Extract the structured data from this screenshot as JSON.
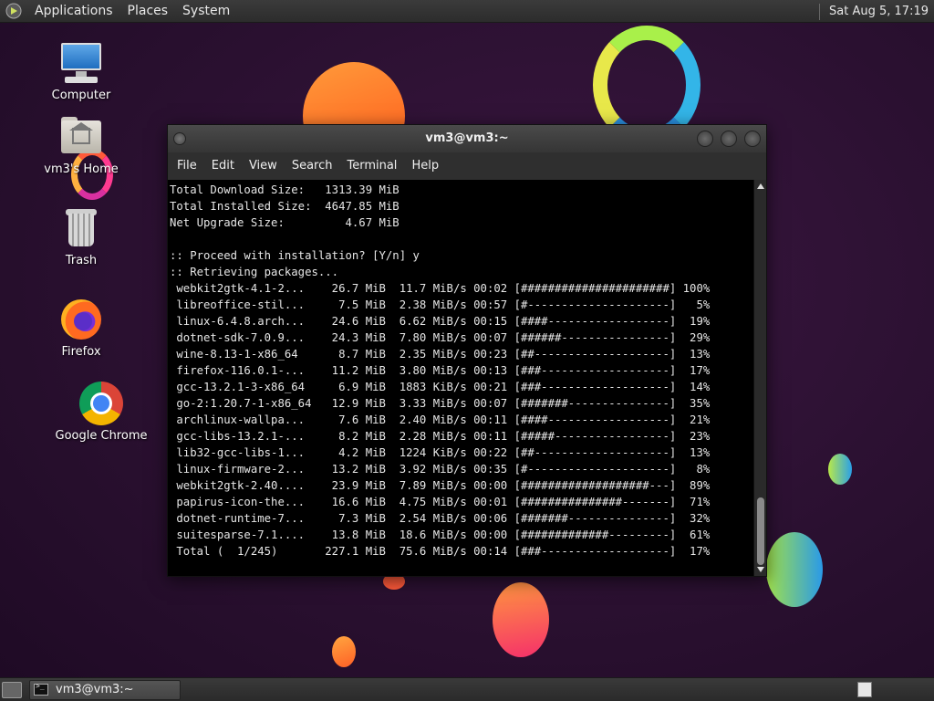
{
  "top_panel": {
    "menus": [
      "Applications",
      "Places",
      "System"
    ],
    "clock": "Sat Aug  5, 17:19"
  },
  "desktop": {
    "icons": [
      {
        "label": "Computer",
        "icon": "computer-icon"
      },
      {
        "label": "vm3's Home",
        "icon": "home-folder-icon"
      },
      {
        "label": "Trash",
        "icon": "trash-icon"
      },
      {
        "label": "Firefox",
        "icon": "firefox-icon"
      },
      {
        "label": "Google Chrome",
        "icon": "chrome-icon"
      }
    ]
  },
  "window": {
    "title": "vm3@vm3:~",
    "menus": [
      "File",
      "Edit",
      "View",
      "Search",
      "Terminal",
      "Help"
    ],
    "terminal_lines": [
      "Total Download Size:   1313.39 MiB",
      "Total Installed Size:  4647.85 MiB",
      "Net Upgrade Size:         4.67 MiB",
      "",
      ":: Proceed with installation? [Y/n] y",
      ":: Retrieving packages...",
      " webkit2gtk-4.1-2...    26.7 MiB  11.7 MiB/s 00:02 [######################] 100%",
      " libreoffice-stil...     7.5 MiB  2.38 MiB/s 00:57 [#---------------------]   5%",
      " linux-6.4.8.arch...    24.6 MiB  6.62 MiB/s 00:15 [####------------------]  19%",
      " dotnet-sdk-7.0.9...    24.3 MiB  7.80 MiB/s 00:07 [######----------------]  29%",
      " wine-8.13-1-x86_64      8.7 MiB  2.35 MiB/s 00:23 [##--------------------]  13%",
      " firefox-116.0.1-...    11.2 MiB  3.80 MiB/s 00:13 [###-------------------]  17%",
      " gcc-13.2.1-3-x86_64     6.9 MiB  1883 KiB/s 00:21 [###-------------------]  14%",
      " go-2:1.20.7-1-x86_64   12.9 MiB  3.33 MiB/s 00:07 [#######---------------]  35%",
      " archlinux-wallpa...     7.6 MiB  2.40 MiB/s 00:11 [####------------------]  21%",
      " gcc-libs-13.2.1-...     8.2 MiB  2.28 MiB/s 00:11 [#####-----------------]  23%",
      " lib32-gcc-libs-1...     4.2 MiB  1224 KiB/s 00:22 [##--------------------]  13%",
      " linux-firmware-2...    13.2 MiB  3.92 MiB/s 00:35 [#---------------------]   8%",
      " webkit2gtk-2.40....    23.9 MiB  7.89 MiB/s 00:00 [###################---]  89%",
      " papirus-icon-the...    16.6 MiB  4.75 MiB/s 00:01 [###############-------]  71%",
      " dotnet-runtime-7...     7.3 MiB  2.54 MiB/s 00:06 [#######---------------]  32%",
      " suitesparse-7.1....    13.8 MiB  18.6 MiB/s 00:00 [#############---------]  61%",
      " Total (  1/245)       227.1 MiB  75.6 MiB/s 00:14 [###-------------------]  17%"
    ]
  },
  "taskbar": {
    "task_label": "vm3@vm3:~"
  }
}
